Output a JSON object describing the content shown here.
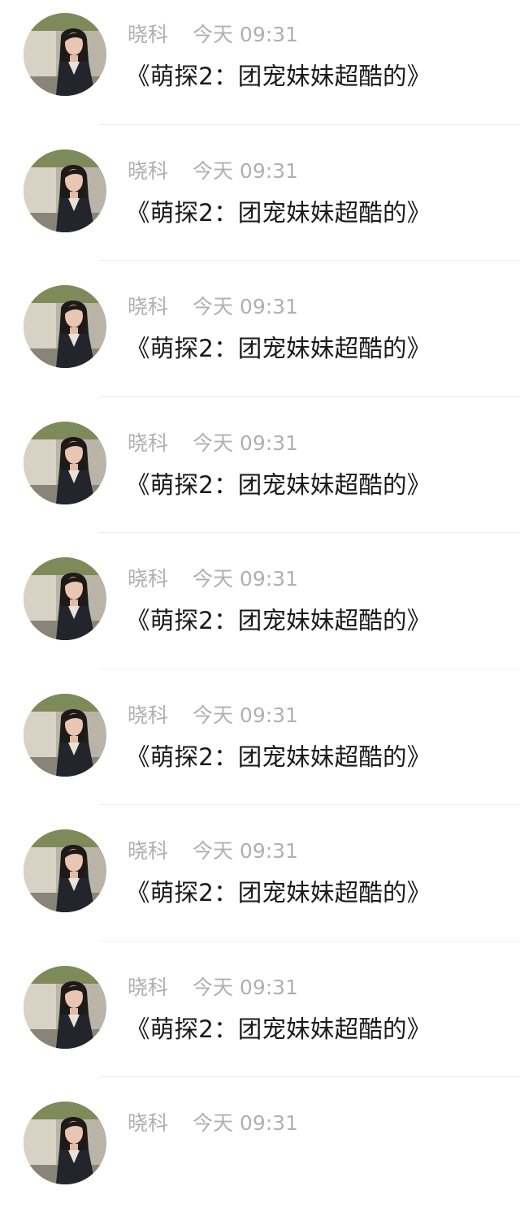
{
  "messages": [
    {
      "sender": "晓科",
      "time": "今天 09:31",
      "text": "《萌探2：团宠妹妹超酷的》"
    },
    {
      "sender": "晓科",
      "time": "今天 09:31",
      "text": "《萌探2：团宠妹妹超酷的》"
    },
    {
      "sender": "晓科",
      "time": "今天 09:31",
      "text": "《萌探2：团宠妹妹超酷的》"
    },
    {
      "sender": "晓科",
      "time": "今天 09:31",
      "text": "《萌探2：团宠妹妹超酷的》"
    },
    {
      "sender": "晓科",
      "time": "今天 09:31",
      "text": "《萌探2：团宠妹妹超酷的》"
    },
    {
      "sender": "晓科",
      "time": "今天 09:31",
      "text": "《萌探2：团宠妹妹超酷的》"
    },
    {
      "sender": "晓科",
      "time": "今天 09:31",
      "text": "《萌探2：团宠妹妹超酷的》"
    },
    {
      "sender": "晓科",
      "time": "今天 09:31",
      "text": "《萌探2：团宠妹妹超酷的》"
    },
    {
      "sender": "晓科",
      "time": "今天 09:31",
      "text": ""
    }
  ],
  "colors": {
    "background": "#ffffff",
    "meta_text": "#b0b0b0",
    "message_text": "#1a1a1a",
    "divider": "#eeeeee"
  },
  "avatar_icon": "user-photo-avatar"
}
